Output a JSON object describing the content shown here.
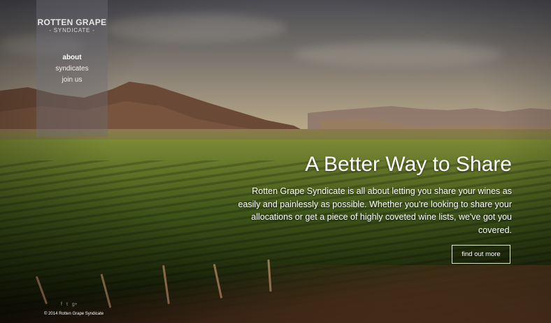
{
  "logo": {
    "name": "ROTTEN GRAPE",
    "sub": "- SYNDICATE -"
  },
  "nav": [
    {
      "label": "about",
      "active": true
    },
    {
      "label": "syndicates",
      "active": false
    },
    {
      "label": "join us",
      "active": false
    }
  ],
  "hero": {
    "title": "A Better Way to Share",
    "body": "Rotten Grape Syndicate is all about letting you share your wines as easily and painlessly as possible. Whether you're looking to share your allocations or get a piece of highly coveted wine lists, we've got you covered.",
    "cta_label": "find out more"
  },
  "footer": {
    "social": [
      {
        "icon": "facebook-icon",
        "glyph": "f"
      },
      {
        "icon": "twitter-icon",
        "glyph": "t"
      },
      {
        "icon": "google-plus-icon",
        "glyph": "g+"
      }
    ],
    "copyright": "© 2014 Rotten Grape Syndicate"
  }
}
